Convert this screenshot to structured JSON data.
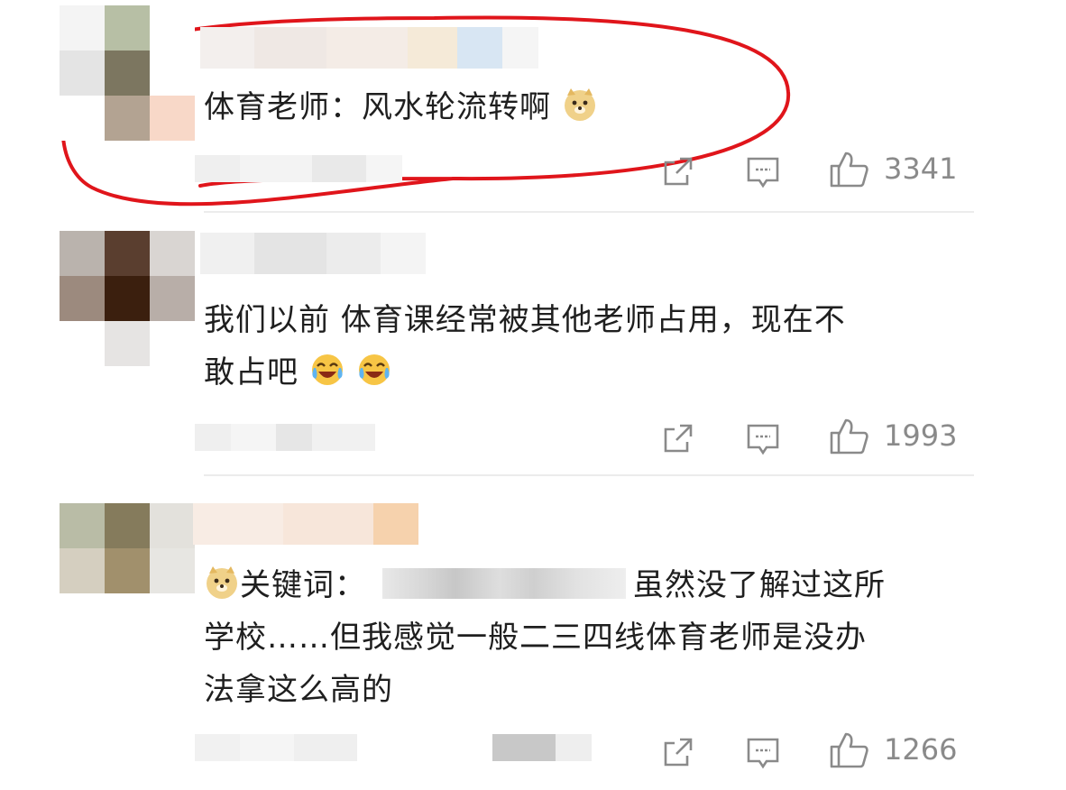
{
  "comments": [
    {
      "text_lines": [
        "体育老师：风水轮流转啊"
      ],
      "likes": "3341",
      "emoji": "doge-emoji"
    },
    {
      "text_lines": [
        "我们以前 体育课经常被其他老师占用，现在不",
        "敢占吧"
      ],
      "likes": "1993",
      "emoji": "laugh-cry-emoji"
    },
    {
      "keyword_label": "关键词：",
      "text_lines": [
        "虽然没了解过这所",
        "学校……但我感觉一般二三四线体育老师是没办",
        "法拿这么高的"
      ],
      "likes": "1266",
      "emoji": "doge-emoji"
    }
  ],
  "colors": {
    "highlight_circle": "#e0151b",
    "icon_gray": "#8a8a8a"
  },
  "icons": [
    "share-icon",
    "comment-icon",
    "like-icon"
  ]
}
